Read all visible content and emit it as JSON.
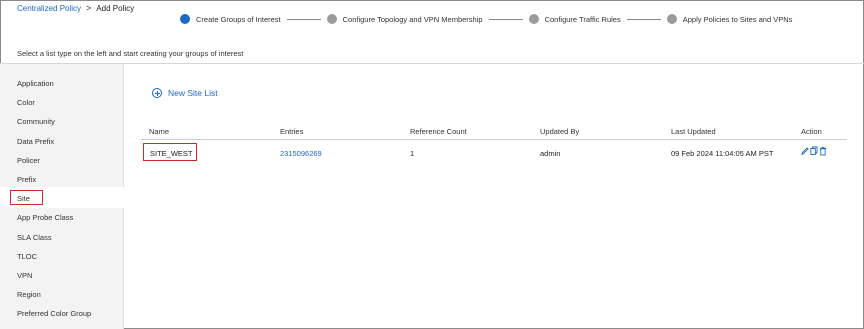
{
  "breadcrumb": {
    "parent": "Centralized Policy",
    "separator": ">",
    "current": "Add Policy"
  },
  "steps": [
    {
      "label": "Create Groups of Interest",
      "active": true
    },
    {
      "label": "Configure Topology and VPN Membership",
      "active": false
    },
    {
      "label": "Configure Traffic Rules",
      "active": false
    },
    {
      "label": "Apply Policies to Sites and VPNs",
      "active": false
    }
  ],
  "instruction": "Select a list type on the left and start creating your groups of interest",
  "sidebar": {
    "items": [
      {
        "label": "Application"
      },
      {
        "label": "Color"
      },
      {
        "label": "Community"
      },
      {
        "label": "Data Prefix"
      },
      {
        "label": "Policer"
      },
      {
        "label": "Prefix"
      },
      {
        "label": "Site",
        "selected": true
      },
      {
        "label": "App Probe Class"
      },
      {
        "label": "SLA Class"
      },
      {
        "label": "TLOC"
      },
      {
        "label": "VPN"
      },
      {
        "label": "Region"
      },
      {
        "label": "Preferred Color Group"
      }
    ]
  },
  "main": {
    "new_list_label": "New Site List",
    "table": {
      "columns": [
        "Name",
        "Entries",
        "Reference Count",
        "Updated By",
        "Last Updated",
        "Action"
      ],
      "rows": [
        {
          "name": "SITE_WEST",
          "entries": "2315096269",
          "reference_count": "1",
          "updated_by": "admin",
          "last_updated": "09 Feb 2024 11:04:05 AM PST"
        }
      ]
    },
    "action_icons": [
      "edit-icon",
      "copy-icon",
      "delete-icon"
    ]
  },
  "colors": {
    "accent": "#1d69c7",
    "inactive_step": "#9b9b9b",
    "highlight": "#d22a2a",
    "sidebar_bg": "#f3f3f3"
  }
}
